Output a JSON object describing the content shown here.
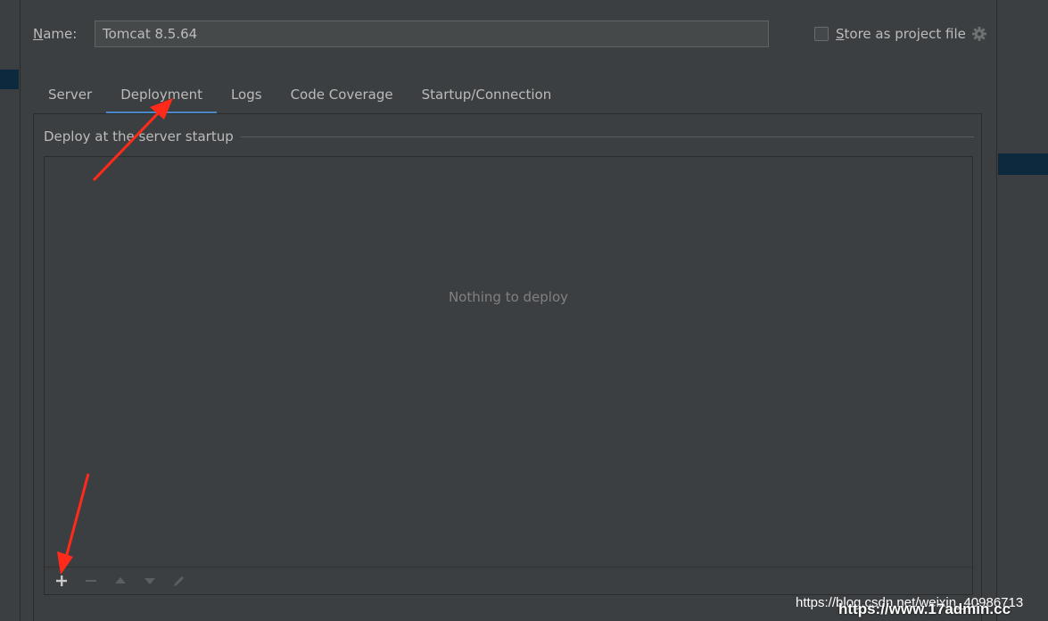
{
  "form": {
    "name_label_key": "N",
    "name_label_rest": "ame:",
    "name_value": "Tomcat 8.5.64",
    "store_key": "S",
    "store_rest": "tore as project file",
    "store_checked": false
  },
  "tabs": [
    {
      "label": "Server",
      "active": false
    },
    {
      "label": "Deployment",
      "active": true
    },
    {
      "label": "Logs",
      "active": false
    },
    {
      "label": "Code Coverage",
      "active": false
    },
    {
      "label": "Startup/Connection",
      "active": false
    }
  ],
  "deployment": {
    "section_title": "Deploy at the server startup",
    "empty_text": "Nothing to deploy"
  },
  "toolbar_icons": [
    "plus-icon",
    "minus-icon",
    "arrow-up-icon",
    "arrow-down-icon",
    "pencil-icon"
  ],
  "watermark": {
    "url_text": "https://blog.csdn.net/weixin_40986713",
    "site_text": "https://www.17admin.cc"
  },
  "colors": {
    "background": "#3c3f41",
    "accent_tab": "#4a88c7",
    "annotation_arrow": "#ff2a1a",
    "selection": "#0d293e"
  }
}
